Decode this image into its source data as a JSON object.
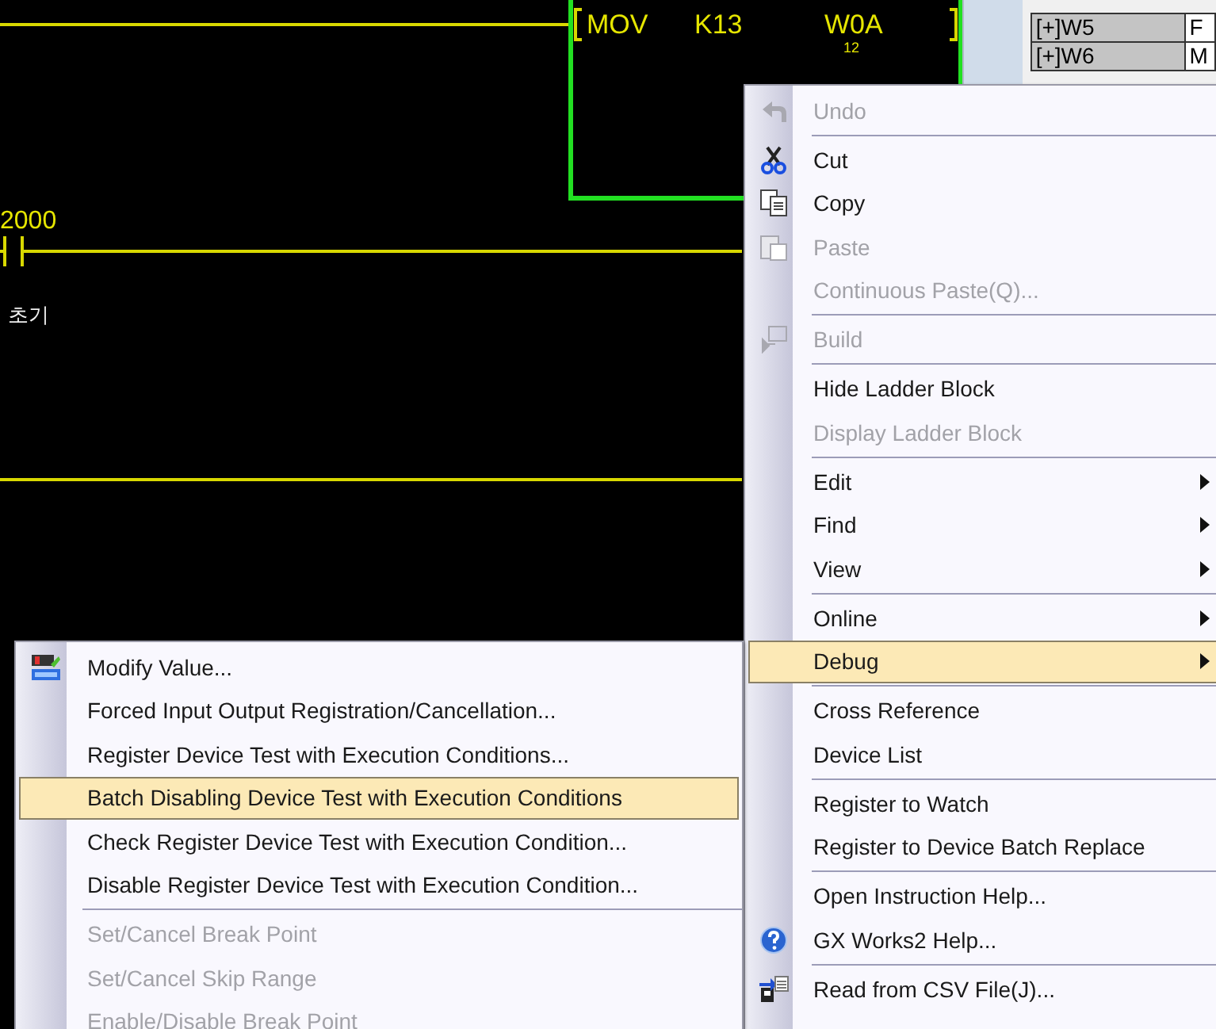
{
  "ladder": {
    "instruction": {
      "name": "MOV",
      "operands": [
        "K13",
        "W0A"
      ],
      "note": "12"
    },
    "contact_label": "2000",
    "comment": "초기"
  },
  "side_table": {
    "rows": [
      {
        "device": "[+]W5",
        "value": "F"
      },
      {
        "device": "[+]W6",
        "value": "M"
      }
    ]
  },
  "main_menu": {
    "items": [
      {
        "kind": "item",
        "label": "Undo",
        "disabled": true,
        "selected": false,
        "submenu": false
      },
      {
        "kind": "separator"
      },
      {
        "kind": "item",
        "label": "Cut",
        "disabled": false,
        "selected": false,
        "submenu": false
      },
      {
        "kind": "item",
        "label": "Copy",
        "disabled": false,
        "selected": false,
        "submenu": false
      },
      {
        "kind": "item",
        "label": "Paste",
        "disabled": true,
        "selected": false,
        "submenu": false
      },
      {
        "kind": "item",
        "label": "Continuous Paste(Q)...",
        "disabled": true,
        "selected": false,
        "submenu": false
      },
      {
        "kind": "separator"
      },
      {
        "kind": "item",
        "label": "Build",
        "disabled": true,
        "selected": false,
        "submenu": false
      },
      {
        "kind": "separator"
      },
      {
        "kind": "item",
        "label": "Hide Ladder Block",
        "disabled": false,
        "selected": false,
        "submenu": false
      },
      {
        "kind": "item",
        "label": "Display Ladder Block",
        "disabled": true,
        "selected": false,
        "submenu": false
      },
      {
        "kind": "separator"
      },
      {
        "kind": "item",
        "label": "Edit",
        "disabled": false,
        "selected": false,
        "submenu": true
      },
      {
        "kind": "item",
        "label": "Find",
        "disabled": false,
        "selected": false,
        "submenu": true
      },
      {
        "kind": "item",
        "label": "View",
        "disabled": false,
        "selected": false,
        "submenu": true
      },
      {
        "kind": "separator"
      },
      {
        "kind": "item",
        "label": "Online",
        "disabled": false,
        "selected": false,
        "submenu": true
      },
      {
        "kind": "item",
        "label": "Debug",
        "disabled": false,
        "selected": true,
        "submenu": true
      },
      {
        "kind": "separator"
      },
      {
        "kind": "item",
        "label": "Cross Reference",
        "disabled": false,
        "selected": false,
        "submenu": false
      },
      {
        "kind": "item",
        "label": "Device List",
        "disabled": false,
        "selected": false,
        "submenu": false
      },
      {
        "kind": "separator"
      },
      {
        "kind": "item",
        "label": "Register to Watch",
        "disabled": false,
        "selected": false,
        "submenu": false
      },
      {
        "kind": "item",
        "label": "Register to Device Batch Replace",
        "disabled": false,
        "selected": false,
        "submenu": false
      },
      {
        "kind": "separator"
      },
      {
        "kind": "item",
        "label": "Open Instruction Help...",
        "disabled": false,
        "selected": false,
        "submenu": false
      },
      {
        "kind": "item",
        "label": "GX Works2 Help...",
        "disabled": false,
        "selected": false,
        "submenu": false
      },
      {
        "kind": "separator"
      },
      {
        "kind": "item",
        "label": "Read from CSV File(J)...",
        "disabled": false,
        "selected": false,
        "submenu": false
      }
    ]
  },
  "debug_submenu": {
    "items": [
      {
        "kind": "item",
        "label": "Modify Value...",
        "disabled": false,
        "selected": false,
        "submenu": false
      },
      {
        "kind": "item",
        "label": "Forced Input Output Registration/Cancellation...",
        "disabled": false,
        "selected": false,
        "submenu": false
      },
      {
        "kind": "item",
        "label": "Register Device Test with Execution Conditions...",
        "disabled": false,
        "selected": false,
        "submenu": false
      },
      {
        "kind": "item",
        "label": "Batch Disabling Device Test with Execution Conditions",
        "disabled": false,
        "selected": true,
        "submenu": false
      },
      {
        "kind": "item",
        "label": "Check Register Device Test with Execution Condition...",
        "disabled": false,
        "selected": false,
        "submenu": false
      },
      {
        "kind": "item",
        "label": "Disable Register Device Test with Execution Condition...",
        "disabled": false,
        "selected": false,
        "submenu": false
      },
      {
        "kind": "separator"
      },
      {
        "kind": "item",
        "label": "Set/Cancel Break Point",
        "disabled": true,
        "selected": false,
        "submenu": false
      },
      {
        "kind": "item",
        "label": "Set/Cancel Skip Range",
        "disabled": true,
        "selected": false,
        "submenu": false
      },
      {
        "kind": "item",
        "label": "Enable/Disable Break Point",
        "disabled": true,
        "selected": false,
        "submenu": false
      }
    ]
  }
}
